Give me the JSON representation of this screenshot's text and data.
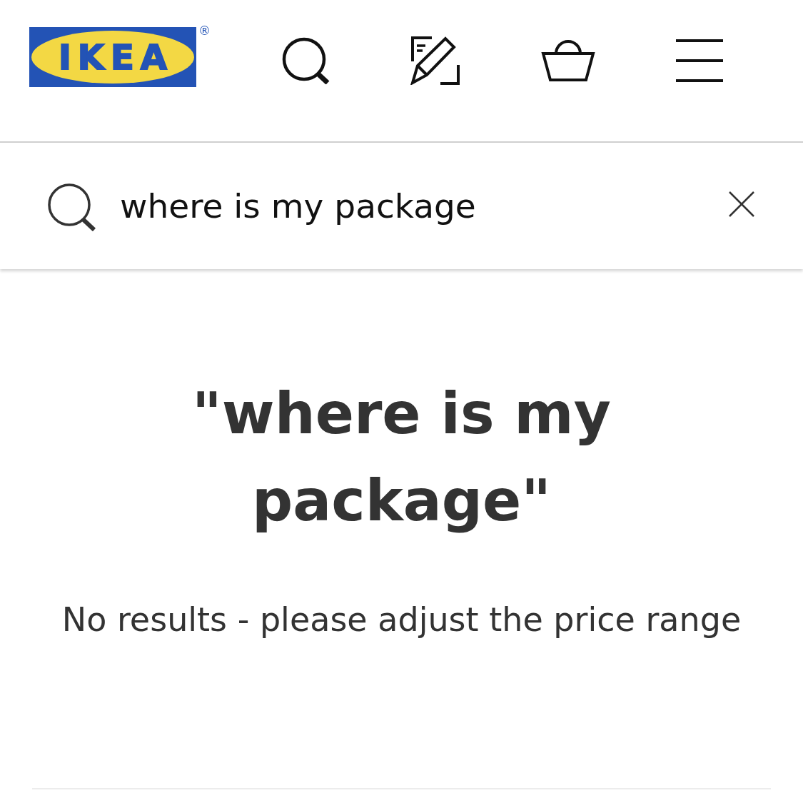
{
  "header": {
    "logo": {
      "wordmark": "IKEA",
      "registered_mark": "®"
    }
  },
  "search": {
    "value": "where is my package"
  },
  "results": {
    "title": "\"where is my package\"",
    "message": "No results - please adjust the price range"
  }
}
